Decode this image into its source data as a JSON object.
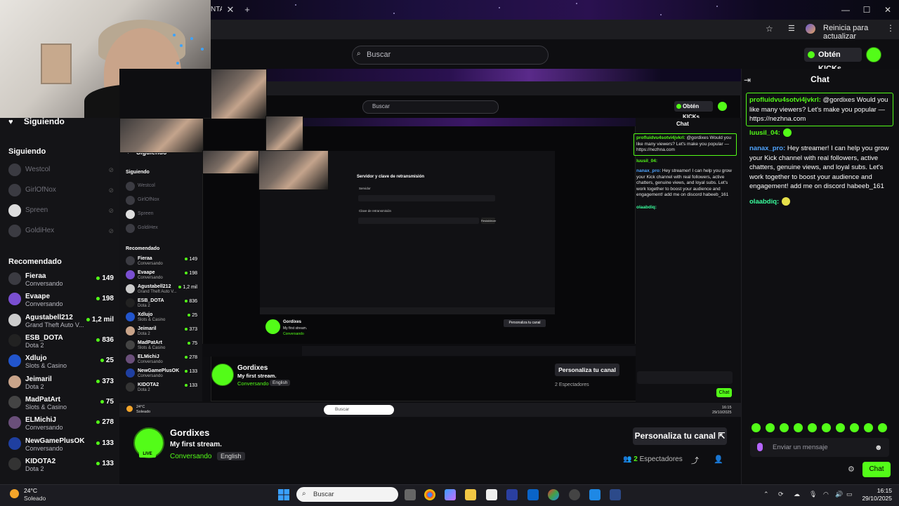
{
  "browser": {
    "tab_text": "NTA",
    "update_button": "Reinicia para actualizar"
  },
  "kick": {
    "search_placeholder": "Buscar",
    "kicks_button": "Obtén KICKs"
  },
  "sidebar": {
    "following_header": "Siguiendo",
    "following_section": "Siguiendo",
    "following": [
      {
        "name": "Westcol"
      },
      {
        "name": "GirlOfNox"
      },
      {
        "name": "Spreen"
      },
      {
        "name": "GoldiHex"
      }
    ],
    "recommended_section": "Recomendado",
    "recommended": [
      {
        "name": "Fieraa",
        "category": "Conversando",
        "viewers": "149"
      },
      {
        "name": "Evaape",
        "category": "Conversando",
        "viewers": "198"
      },
      {
        "name": "Agustabell212",
        "category": "Grand Theft Auto V...",
        "viewers": "1,2 mil"
      },
      {
        "name": "ESB_DOTA",
        "category": "Dota 2",
        "viewers": "836"
      },
      {
        "name": "Xdlujo",
        "category": "Slots & Casino",
        "viewers": "25"
      },
      {
        "name": "Jeimaril",
        "category": "Dota 2",
        "viewers": "373"
      },
      {
        "name": "MadPatArt",
        "category": "Slots & Casino",
        "viewers": "75"
      },
      {
        "name": "ELMichiJ",
        "category": "Conversando",
        "viewers": "278"
      },
      {
        "name": "NewGamePlusOK",
        "category": "Conversando",
        "viewers": "133"
      },
      {
        "name": "KIDOTA2",
        "category": "Dota 2",
        "viewers": "133"
      }
    ]
  },
  "nested": {
    "search_placeholder": "Buscar",
    "kicks_button": "Obtén KICKs",
    "chat_title": "Chat",
    "following_header": "Siguiendo",
    "following_section": "Siguiendo",
    "recommended_section": "Recomendado",
    "following": [
      {
        "name": "Westcol"
      },
      {
        "name": "GirlOfNox"
      },
      {
        "name": "Spreen"
      },
      {
        "name": "GoldiHex"
      }
    ],
    "recommended": [
      {
        "name": "Fieraa",
        "category": "Conversando",
        "viewers": "149"
      },
      {
        "name": "Evaape",
        "category": "Conversando",
        "viewers": "198"
      },
      {
        "name": "Agustabell212",
        "category": "Grand Theft Auto V...",
        "viewers": "1,2 mil"
      },
      {
        "name": "ESB_DOTA",
        "category": "Dota 2",
        "viewers": "836"
      },
      {
        "name": "Xdlujo",
        "category": "Slots & Casino",
        "viewers": "25"
      },
      {
        "name": "Jeimaril",
        "category": "Dota 2",
        "viewers": "373"
      },
      {
        "name": "MadPatArt",
        "category": "Slots & Casino",
        "viewers": "75"
      },
      {
        "name": "ELMichiJ",
        "category": "Conversando",
        "viewers": "278"
      },
      {
        "name": "NewGamePlusOK",
        "category": "Conversando",
        "viewers": "133"
      },
      {
        "name": "KIDOTA2",
        "category": "Dota 2",
        "viewers": "133"
      }
    ],
    "pinned_user": "profluidvu4sotvi4jvkrl:",
    "pinned_text": "@gordixes Would you like many viewers? Let's make you popular — https://nezhna.com",
    "msg2_user": "luusil_04:",
    "msg3_user": "nanax_pro:",
    "msg3_text": "Hey streamer! I can help you grow your Kick channel with real followers, active chatters, genuine views, and loyal subs. Let's work together to boost your audience and engagement! add me on discord habeeb_161",
    "msg4_user": "olaabdiq:"
  },
  "deep": {
    "heading": "Servidor y clave de retransmisión",
    "server_label": "Servidor",
    "key_label": "Clave de retransmisión",
    "reset_button": "Restablecer",
    "stream_name": "Gordixes",
    "stream_title": "My first stream.",
    "stream_category": "Conversando",
    "personalize": "Personaliza tu canal"
  },
  "stream": {
    "name": "Gordixes",
    "title": "My first stream.",
    "category": "Conversando",
    "language": "English",
    "personalize": "Personaliza tu canal",
    "viewers_count": "2",
    "viewers_label": "Espectadores",
    "live_badge": "LIVE"
  },
  "inner_taskbar": {
    "weather_temp": "24°C",
    "weather_cond": "Soleado",
    "search": "Buscar",
    "time": "16:15",
    "date": "29/10/2025"
  },
  "chat": {
    "title": "Chat",
    "messages": [
      {
        "user": "profluidvu4sotvi4jvkrl:",
        "text": "@gordixes Would you like many viewers? Let's make you popular — https://nezhna.com"
      },
      {
        "user": "luusil_04:",
        "text": ""
      },
      {
        "user": "nanax_pro:",
        "text": "Hey streamer! I can help you grow your Kick channel with real followers, active chatters, genuine views, and loyal subs. Let's work together to boost your audience and engagement! add me on discord habeeb_161"
      },
      {
        "user": "olaabdiq:",
        "text": ""
      }
    ],
    "input_placeholder": "Enviar un mensaje",
    "send_button": "Chat"
  },
  "taskbar": {
    "weather_temp": "24°C",
    "weather_cond": "Soleado",
    "search_placeholder": "Buscar",
    "time": "16:15",
    "date": "29/10/2025"
  },
  "colors": {
    "kick_green": "#53fc18",
    "background": "#0e0e11",
    "accent_purple": "#b565ff"
  }
}
